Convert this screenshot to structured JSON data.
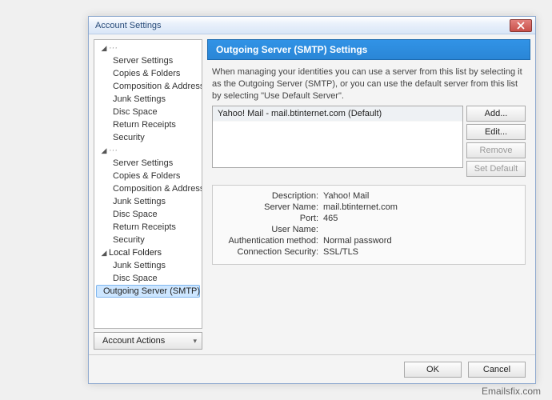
{
  "window": {
    "title": "Account Settings"
  },
  "tree": {
    "account1": {
      "serverSettings": "Server Settings",
      "copies": "Copies & Folders",
      "composition": "Composition & Addressing",
      "junk": "Junk Settings",
      "discSpace": "Disc Space",
      "returnReceipts": "Return Receipts",
      "security": "Security"
    },
    "account2": {
      "serverSettings": "Server Settings",
      "copies": "Copies & Folders",
      "composition": "Composition & Addressing",
      "junk": "Junk Settings",
      "discSpace": "Disc Space",
      "returnReceipts": "Return Receipts",
      "security": "Security"
    },
    "localFolders": {
      "label": "Local Folders",
      "junk": "Junk Settings",
      "discSpace": "Disc Space"
    },
    "smtp": "Outgoing Server (SMTP)"
  },
  "accountActions": "Account Actions",
  "panel": {
    "header": "Outgoing Server (SMTP) Settings",
    "intro": "When managing your identities you can use a server from this list by selecting it as the Outgoing Server (SMTP), or you can use the default server from this list by selecting \"Use Default Server\".",
    "serverList": [
      "Yahoo! Mail - mail.btinternet.com (Default)"
    ],
    "buttons": {
      "add": "Add...",
      "edit": "Edit...",
      "remove": "Remove",
      "setDefault": "Set Default"
    },
    "details": {
      "labels": {
        "description": "Description:",
        "serverName": "Server Name:",
        "port": "Port:",
        "userName": "User Name:",
        "authMethod": "Authentication method:",
        "connSecurity": "Connection Security:"
      },
      "values": {
        "description": "Yahoo! Mail",
        "serverName": "mail.btinternet.com",
        "port": "465",
        "userName": "",
        "authMethod": "Normal password",
        "connSecurity": "SSL/TLS"
      }
    }
  },
  "footer": {
    "ok": "OK",
    "cancel": "Cancel"
  },
  "watermark": "Emailsfix.com"
}
